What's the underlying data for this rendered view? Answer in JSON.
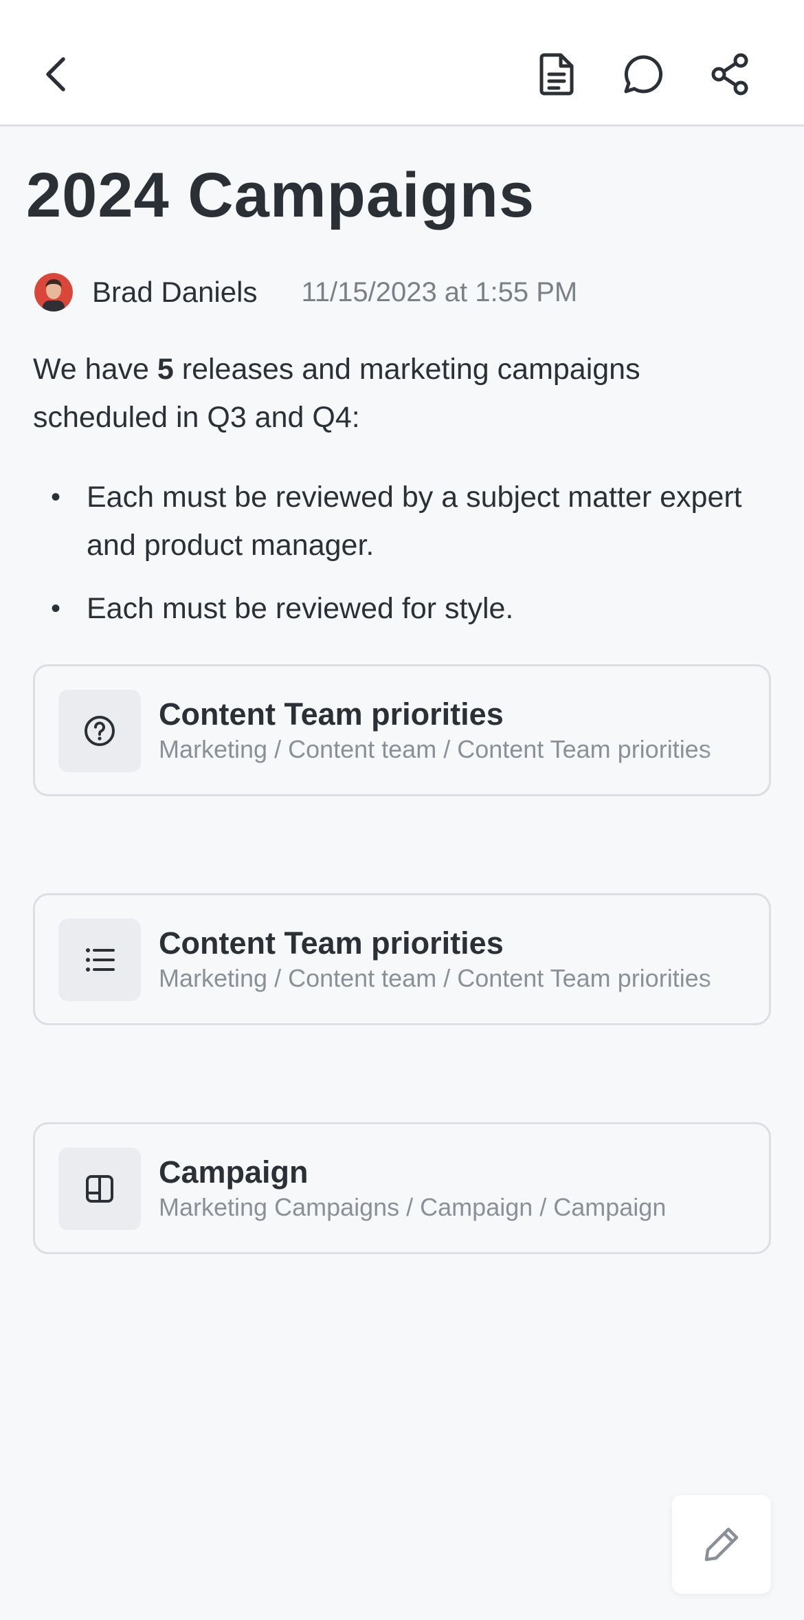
{
  "header": {
    "back_icon": "chevron-left-icon",
    "document_icon": "document-icon",
    "comment_icon": "comment-icon",
    "share_icon": "share-icon"
  },
  "page": {
    "title": "2024 Campaigns",
    "author": "Brad Daniels",
    "timestamp": "11/15/2023 at 1:55 PM",
    "intro_before": "We have ",
    "intro_bold": "5",
    "intro_after": " releases and marketing campaigns scheduled in Q3 and Q4:",
    "bullets": [
      "Each must be reviewed by a subject matter expert and product manager.",
      "Each must be reviewed for style."
    ]
  },
  "cards": [
    {
      "icon": "question-circle-icon",
      "title": "Content Team priorities",
      "path": "Marketing / Content team / Content Team priorities"
    },
    {
      "icon": "list-icon",
      "title": "Content Team priorities",
      "path": "Marketing / Content team / Content Team priorities"
    },
    {
      "icon": "board-icon",
      "title": "Campaign",
      "path": "Marketing Campaigns / Campaign / Campaign"
    }
  ],
  "fab": {
    "icon": "pencil-icon"
  },
  "colors": {
    "text": "#2b2f36",
    "muted": "#7a7f88",
    "border": "#dcdee2",
    "background": "#f7f8fa"
  }
}
